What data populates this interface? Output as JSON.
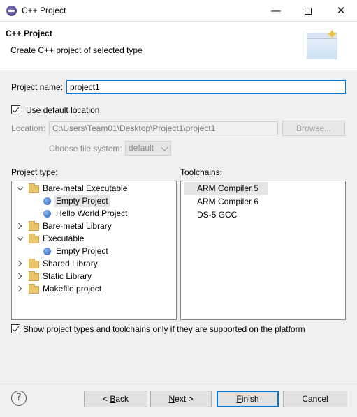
{
  "window": {
    "title": "C++ Project",
    "minimize": "—",
    "close": "✕"
  },
  "banner": {
    "title": "C++ Project",
    "subtitle": "Create C++ project of selected type"
  },
  "project_name": {
    "label_prefix": "P",
    "label_rest": "roject name:",
    "value": "project1"
  },
  "use_default_location": {
    "checked": true,
    "label_pre": "Use ",
    "label_u": "d",
    "label_post": "efault location"
  },
  "location": {
    "label_u": "L",
    "label_rest": "ocation:",
    "value": "C:\\Users\\Team01\\Desktop\\Project1\\project1",
    "browse_u": "B",
    "browse_rest": "rowse..."
  },
  "file_system": {
    "label": "Choose file system:",
    "value": "default"
  },
  "project_type": {
    "label": "Project type:",
    "items": [
      {
        "label": "Bare-metal Executable",
        "kind": "folder",
        "state": "open"
      },
      {
        "label": "Empty Project",
        "kind": "leaf",
        "selected": true
      },
      {
        "label": "Hello World Project",
        "kind": "leaf"
      },
      {
        "label": "Bare-metal Library",
        "kind": "folder",
        "state": "closed"
      },
      {
        "label": "Executable",
        "kind": "folder",
        "state": "open"
      },
      {
        "label": "Empty Project",
        "kind": "leaf"
      },
      {
        "label": "Shared Library",
        "kind": "folder",
        "state": "closed"
      },
      {
        "label": "Static Library",
        "kind": "folder",
        "state": "closed"
      },
      {
        "label": "Makefile project",
        "kind": "folder",
        "state": "closed"
      }
    ]
  },
  "toolchains": {
    "label": "Toolchains:",
    "items": [
      {
        "label": "ARM Compiler 5",
        "selected": true
      },
      {
        "label": "ARM Compiler 6"
      },
      {
        "label": "DS-5 GCC"
      }
    ]
  },
  "show_supported": {
    "checked": true,
    "label": "Show project types and toolchains only if they are supported on the platform"
  },
  "buttons": {
    "help": "?",
    "back_pre": "< ",
    "back_u": "B",
    "back_rest": "ack",
    "next_u": "N",
    "next_rest": "ext >",
    "finish_u": "F",
    "finish_rest": "inish",
    "cancel": "Cancel"
  },
  "colors": {
    "accent": "#0078d7",
    "selection": "#e5e5e5",
    "folder": "#e9c56b"
  }
}
